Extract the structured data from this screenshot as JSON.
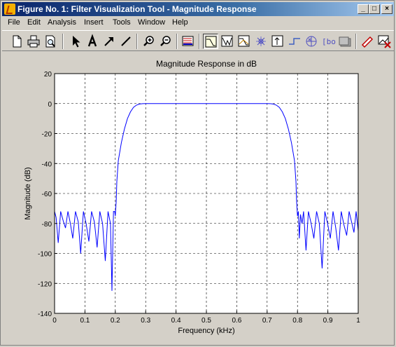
{
  "window": {
    "title": "Figure No. 1: Filter Visualization Tool - Magnitude Response",
    "controls": [
      "_",
      "□",
      "×"
    ]
  },
  "menubar": {
    "items": [
      "File",
      "Edit",
      "Analysis",
      "Insert",
      "Tools",
      "Window",
      "Help"
    ]
  },
  "toolbar": {
    "buttons": [
      "new-figure-icon",
      "print-icon",
      "print-preview-icon",
      "select-arrow-icon",
      "insert-text-icon",
      "insert-arrow-icon",
      "insert-line-icon",
      "zoom-in-icon",
      "zoom-out-icon",
      "filter-specifications-icon",
      "magnitude-response-icon",
      "phase-response-icon",
      "magnitude-and-phase-icon",
      "group-delay-icon",
      "impulse-response-icon",
      "step-response-icon",
      "pole-zero-plot-icon",
      "filter-coefficients-icon",
      "filter-information-icon",
      "full-view-icon",
      "new-window-icon"
    ]
  },
  "colors": {
    "titlebar_start": "#0a246a",
    "titlebar_end": "#a6caf0",
    "window_face": "#d4d0c8",
    "plot_background": "#ffffff",
    "trace": "#0000ff"
  },
  "chart_data": {
    "type": "line",
    "title": "Magnitude Response in dB",
    "xlabel": "Frequency (kHz)",
    "ylabel": "Magnitude (dB)",
    "xlim": [
      0,
      1
    ],
    "ylim": [
      -140,
      20
    ],
    "xticks": [
      "0",
      "0.1",
      "0.2",
      "0.3",
      "0.4",
      "0.5",
      "0.6",
      "0.7",
      "0.8",
      "0.9",
      "1"
    ],
    "yticks": [
      "20",
      "0",
      "-20",
      "-40",
      "-60",
      "-80",
      "-100",
      "-120",
      "-140"
    ],
    "grid": true,
    "series": [
      {
        "color": "#0000ff",
        "x": [
          0.0,
          0.005,
          0.012,
          0.02,
          0.028,
          0.036,
          0.044,
          0.052,
          0.06,
          0.069,
          0.078,
          0.086,
          0.095,
          0.104,
          0.113,
          0.122,
          0.131,
          0.14,
          0.149,
          0.158,
          0.167,
          0.176,
          0.184,
          0.189,
          0.194,
          0.198,
          0.2,
          0.203,
          0.205,
          0.21,
          0.22,
          0.23,
          0.24,
          0.25,
          0.26,
          0.27,
          0.28,
          0.29,
          0.3,
          0.4,
          0.5,
          0.6,
          0.7,
          0.71,
          0.72,
          0.73,
          0.74,
          0.75,
          0.76,
          0.77,
          0.78,
          0.79,
          0.795,
          0.797,
          0.8,
          0.803,
          0.806,
          0.81,
          0.815,
          0.82,
          0.828,
          0.836,
          0.845,
          0.854,
          0.863,
          0.872,
          0.881,
          0.89,
          0.899,
          0.908,
          0.917,
          0.926,
          0.935,
          0.944,
          0.953,
          0.962,
          0.97,
          0.978,
          0.986,
          0.993,
          1.0
        ],
        "y": [
          -72,
          -76,
          -93,
          -72,
          -78,
          -83,
          -72,
          -80,
          -90,
          -72,
          -79,
          -100,
          -72,
          -80,
          -92,
          -72,
          -79,
          -96,
          -72,
          -80,
          -105,
          -72,
          -80,
          -125,
          -72,
          -72,
          -75,
          -65,
          -52,
          -38,
          -26,
          -17,
          -10,
          -5.5,
          -2.5,
          -1,
          -0.3,
          -0.05,
          0,
          0,
          0,
          0,
          0,
          -0.05,
          -0.3,
          -1,
          -2.5,
          -5.5,
          -10,
          -17,
          -26,
          -38,
          -52,
          -65,
          -75,
          -72,
          -90,
          -74,
          -80,
          -72,
          -98,
          -72,
          -80,
          -90,
          -72,
          -80,
          -110,
          -72,
          -80,
          -90,
          -72,
          -83,
          -98,
          -72,
          -81,
          -88,
          -72,
          -79,
          -86,
          -72,
          -85
        ]
      }
    ]
  }
}
